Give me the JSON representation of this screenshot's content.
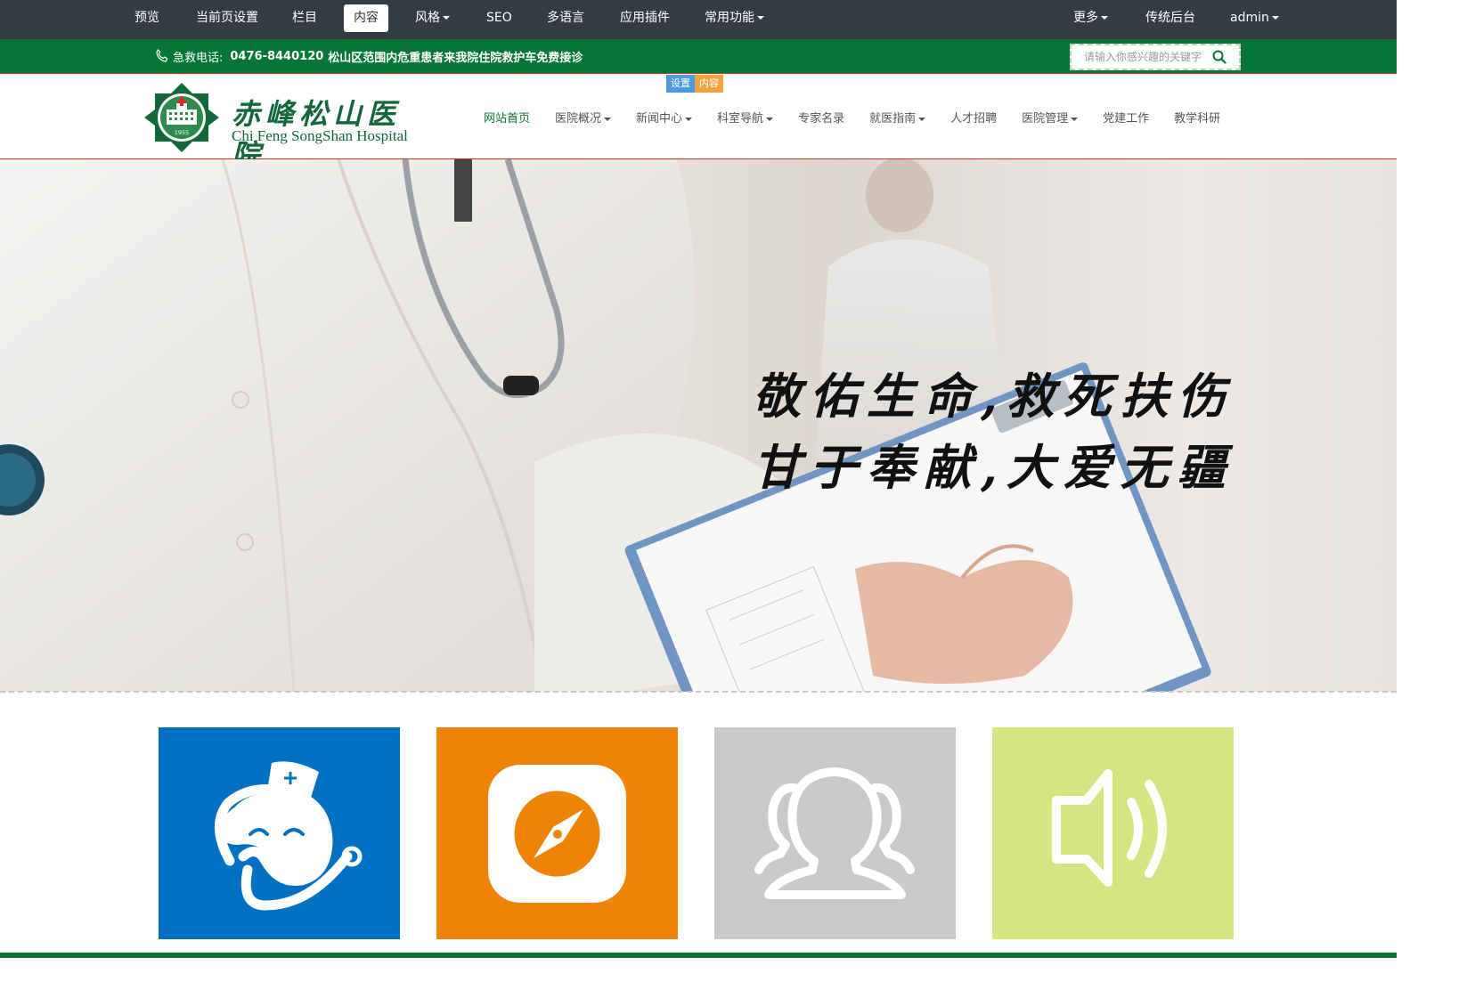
{
  "admin_bar": {
    "preview": "预览",
    "page_settings": "当前页设置",
    "columns": "栏目",
    "content": "内容",
    "style": "风格",
    "seo": "SEO",
    "multilang": "多语言",
    "plugins": "应用插件",
    "common": "常用功能",
    "more": "更多",
    "classic_backend": "传统后台",
    "user": "admin"
  },
  "topbar": {
    "hotline_label": "急救电话:",
    "hotline_number": "0476-8440120",
    "hotline_text": "松山区范围内危重患者来我院住院救护车免费接诊",
    "search_placeholder": "请输入你感兴趣的关键字"
  },
  "edit_badges": {
    "setting": "设置",
    "content": "内容"
  },
  "logo": {
    "name_cn": "赤峰松山医院",
    "name_en": "Chi Feng SongShan Hospital",
    "seal_year": "1955"
  },
  "nav": {
    "items": [
      {
        "label": "网站首页",
        "dropdown": false,
        "active": true
      },
      {
        "label": "医院概况",
        "dropdown": true,
        "active": false
      },
      {
        "label": "新闻中心",
        "dropdown": true,
        "active": false
      },
      {
        "label": "科室导航",
        "dropdown": true,
        "active": false
      },
      {
        "label": "专家名录",
        "dropdown": false,
        "active": false
      },
      {
        "label": "就医指南",
        "dropdown": true,
        "active": false
      },
      {
        "label": "人才招聘",
        "dropdown": false,
        "active": false
      },
      {
        "label": "医院管理",
        "dropdown": true,
        "active": false
      },
      {
        "label": "党建工作",
        "dropdown": false,
        "active": false
      },
      {
        "label": "教学科研",
        "dropdown": false,
        "active": false
      }
    ]
  },
  "banner": {
    "slogan_line1": "敬佑生命,救死扶伤",
    "slogan_line2": "甘于奉献,大爱无疆"
  },
  "tiles": [
    {
      "icon": "nurse-icon",
      "color": "#0071c2"
    },
    {
      "icon": "compass-icon",
      "color": "#ee8305"
    },
    {
      "icon": "users-icon",
      "color": "#c8c9cb"
    },
    {
      "icon": "speaker-icon",
      "color": "#d7e482"
    }
  ],
  "colors": {
    "brand_green": "#077634",
    "admin_bar": "#353b44",
    "accent_red": "#cf2c2c"
  }
}
